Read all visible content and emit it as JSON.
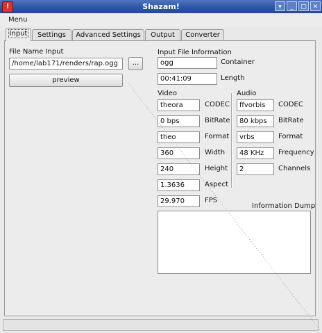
{
  "window": {
    "title": "Shazam!",
    "icon": "shazam-app-icon"
  },
  "menu": {
    "items": [
      "Menu"
    ]
  },
  "tabs": [
    "Input",
    "Settings",
    "Advanced Settings",
    "Output",
    "Converter"
  ],
  "active_tab": "Input",
  "file_input": {
    "heading": "File Name Input",
    "path": "/home/lab171/renders/rap.ogg",
    "browse_label": "...",
    "preview_label": "preview"
  },
  "file_info": {
    "heading": "Input File Information",
    "container_value": "ogg",
    "container_label": "Container",
    "length_value": "00:41:09",
    "length_label": "Length"
  },
  "video": {
    "heading": "Video",
    "rows": [
      {
        "value": "theora",
        "label": "CODEC"
      },
      {
        "value": "0 bps",
        "label": "BitRate"
      },
      {
        "value": "theo",
        "label": "Format"
      },
      {
        "value": "360",
        "label": "Width"
      },
      {
        "value": "240",
        "label": "Height"
      },
      {
        "value": "1.3636",
        "label": "Aspect"
      },
      {
        "value": "29.970",
        "label": "FPS"
      }
    ]
  },
  "audio": {
    "heading": "Audio",
    "rows": [
      {
        "value": "ffvorbis",
        "label": "CODEC"
      },
      {
        "value": "80 kbps",
        "label": "BitRate"
      },
      {
        "value": "vrbs",
        "label": "Format"
      },
      {
        "value": "48 KHz",
        "label": "Frequency"
      },
      {
        "value": "2",
        "label": "Channels"
      }
    ]
  },
  "dump": {
    "heading": "Information Dump",
    "content": ""
  },
  "colors": {
    "titlebar": "#2f56a6",
    "background": "#ececec",
    "field": "#ffffff"
  }
}
